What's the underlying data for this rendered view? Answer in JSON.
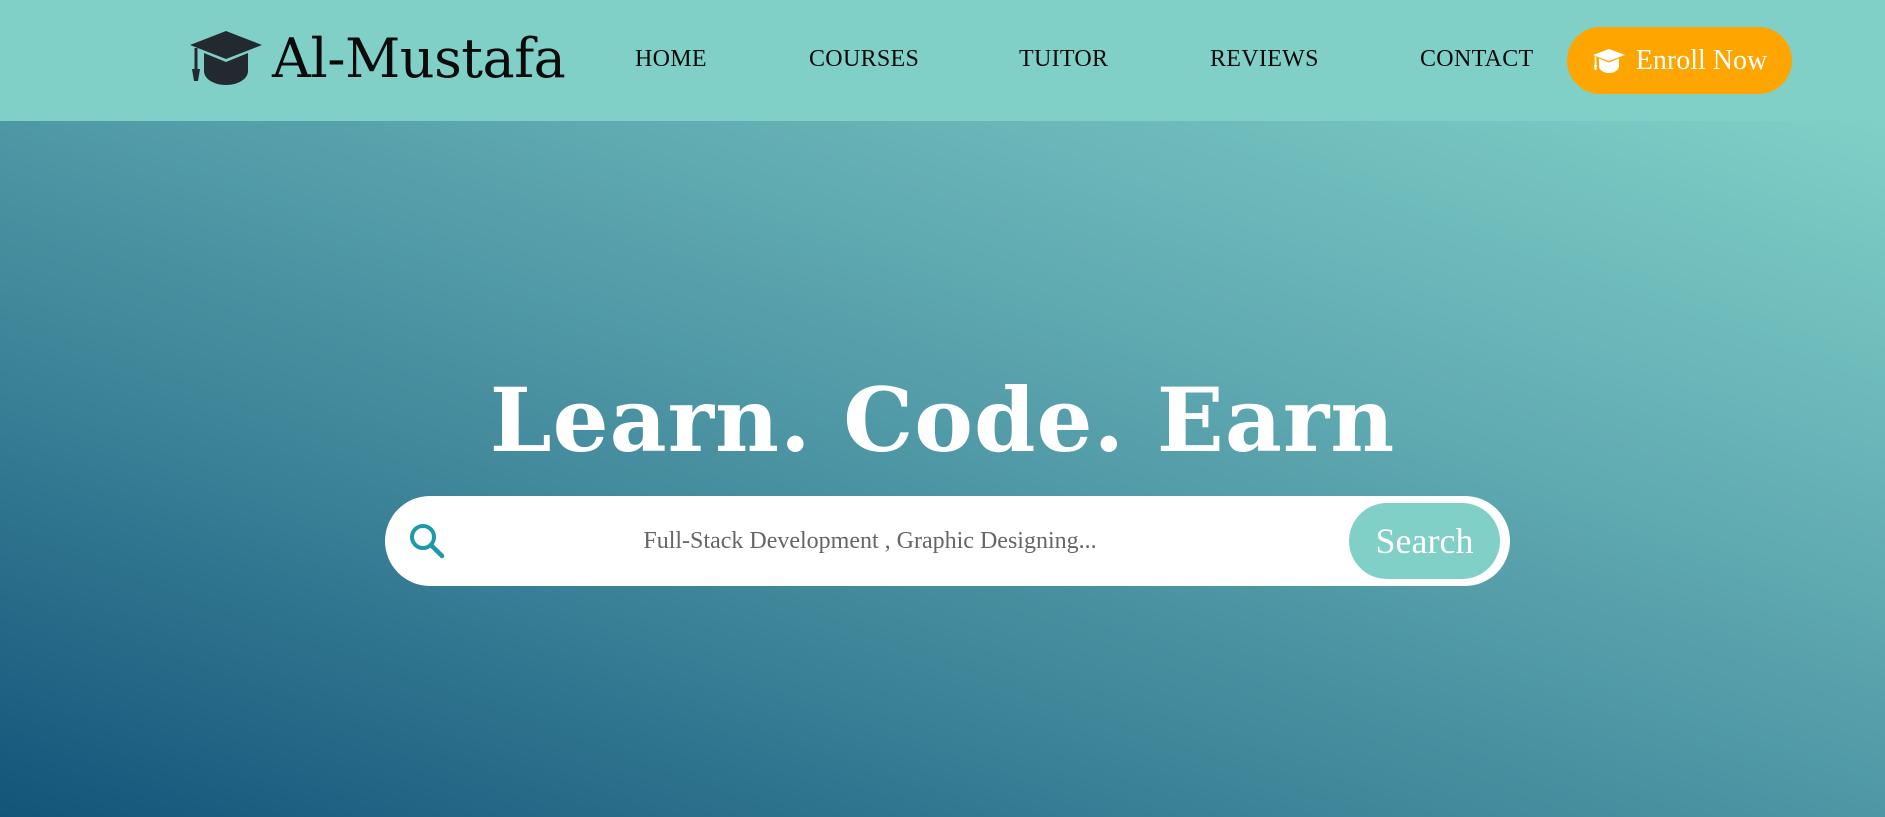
{
  "brand": {
    "name": "Al-Mustafa",
    "icon": "graduation-cap-icon"
  },
  "nav": {
    "items": [
      {
        "label": "HOME"
      },
      {
        "label": "COURSES"
      },
      {
        "label": "TUITOR"
      },
      {
        "label": "REVIEWS"
      },
      {
        "label": "CONTACT"
      }
    ]
  },
  "enroll": {
    "label": "Enroll Now",
    "icon": "graduation-cap-icon"
  },
  "hero": {
    "title": "Learn. Code. Earn"
  },
  "search": {
    "icon": "search-icon",
    "placeholder": "Full-Stack Development , Graphic Designing...",
    "button_label": "Search"
  },
  "colors": {
    "header_bg": "#80d0c7",
    "accent_orange": "#ffa500",
    "search_icon": "#1a9aab",
    "gradient_start": "#80d0c7",
    "gradient_end": "#13547a"
  }
}
